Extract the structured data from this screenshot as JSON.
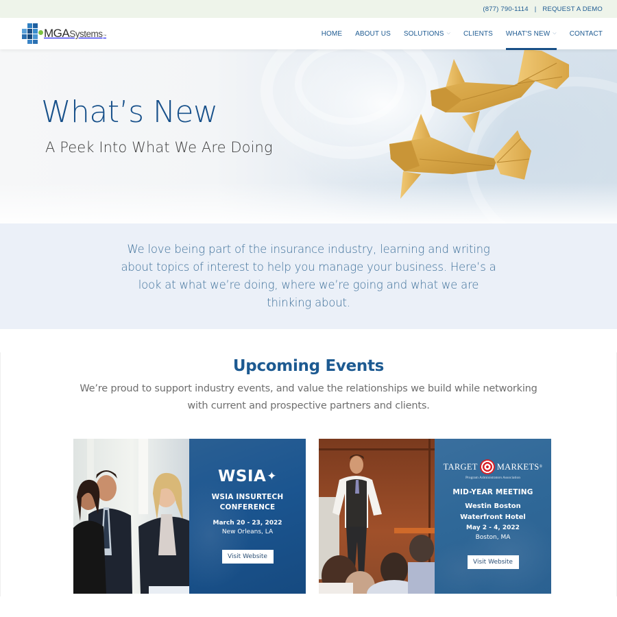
{
  "topbar": {
    "phone": "(877) 790-1114",
    "separator": "|",
    "request_demo": "REQUEST A DEMO"
  },
  "header": {
    "logo": {
      "name": "MGA",
      "suffix": "Systems",
      "trademark": "™"
    },
    "nav": [
      {
        "label": "HOME",
        "has_dropdown": false,
        "active": false
      },
      {
        "label": "ABOUT US",
        "has_dropdown": false,
        "active": false
      },
      {
        "label": "SOLUTIONS",
        "has_dropdown": true,
        "active": false
      },
      {
        "label": "CLIENTS",
        "has_dropdown": false,
        "active": false
      },
      {
        "label": "WHAT'S NEW",
        "has_dropdown": true,
        "active": true
      },
      {
        "label": "CONTACT",
        "has_dropdown": false,
        "active": false
      }
    ],
    "chevron": "⌵"
  },
  "hero": {
    "title": "What’s New",
    "subtitle": "A Peek Into What We Are Doing"
  },
  "intro": {
    "text": "We love being part of the insurance industry, learning and writing about topics of interest to help you manage your business. Here’s a look at what we’re doing, where we’re going and what we are thinking about."
  },
  "events": {
    "title": "Upcoming Events",
    "subtitle": "We’re proud to support industry events, and value the relationships we build while networking with current and prospective partners and clients.",
    "cards": [
      {
        "logo_text": "WSIA",
        "logo_mark": "✦",
        "name_line1": "WSIA INSURTECH",
        "name_line2": "CONFERENCE",
        "date": "March 20 - 23, 2022",
        "location": "New Orleans, LA",
        "button": "Visit Website"
      },
      {
        "logo_left": "TARGET",
        "logo_right": "MARKETS",
        "logo_reg": "®",
        "logo_tagline": "Program Administrators Association",
        "meeting": "MID-YEAR MEETING",
        "venue_line1": "Westin Boston",
        "venue_line2": "Waterfront Hotel",
        "date": "May 2 - 4, 2022",
        "location": "Boston, MA",
        "button": "Visit Website"
      }
    ]
  },
  "colors": {
    "brand_blue": "#1d5a91",
    "topbar_bg": "#eef4ea",
    "intro_bg": "#ebf0f8",
    "active_underline": "#174f86",
    "logo_green": "#7cc242"
  }
}
